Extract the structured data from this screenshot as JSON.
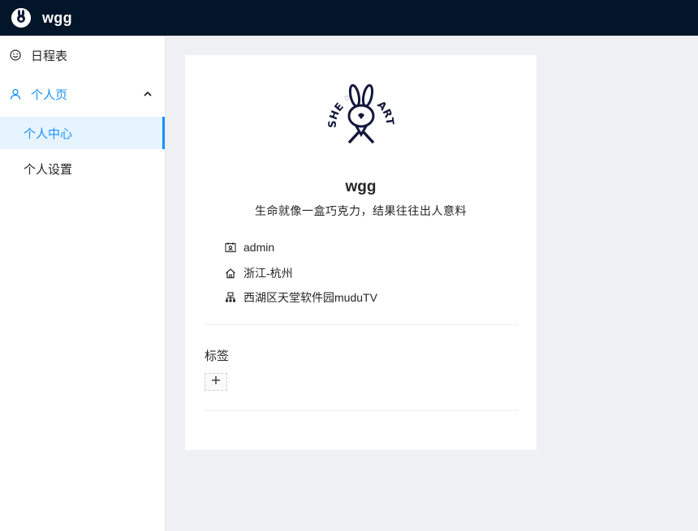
{
  "header": {
    "brand": "wgg",
    "logo_icon": "rabbit-logo-icon"
  },
  "sidebar": {
    "items": [
      {
        "label": "日程表",
        "icon": "smile-icon"
      },
      {
        "label": "个人页",
        "icon": "user-icon",
        "expanded": true,
        "children": [
          {
            "label": "个人中心",
            "active": true
          },
          {
            "label": "个人设置"
          }
        ]
      }
    ]
  },
  "profile": {
    "name": "wgg",
    "motto": "生命就像一盒巧克力，结果往往出人意料",
    "avatar_text": [
      "SHE",
      "ART"
    ],
    "info": [
      {
        "icon": "contacts-icon",
        "text": "admin"
      },
      {
        "icon": "home-icon",
        "text": "浙江-杭州"
      },
      {
        "icon": "cluster-icon",
        "text": "西湖区天堂软件园muduTV"
      }
    ],
    "tags_title": "标签",
    "add_tag_icon": "plus-icon"
  },
  "colors": {
    "topbar": "#031529",
    "accent": "#1890ff",
    "active_bg": "#e6f4ff",
    "content_bg": "#eef0f3"
  }
}
